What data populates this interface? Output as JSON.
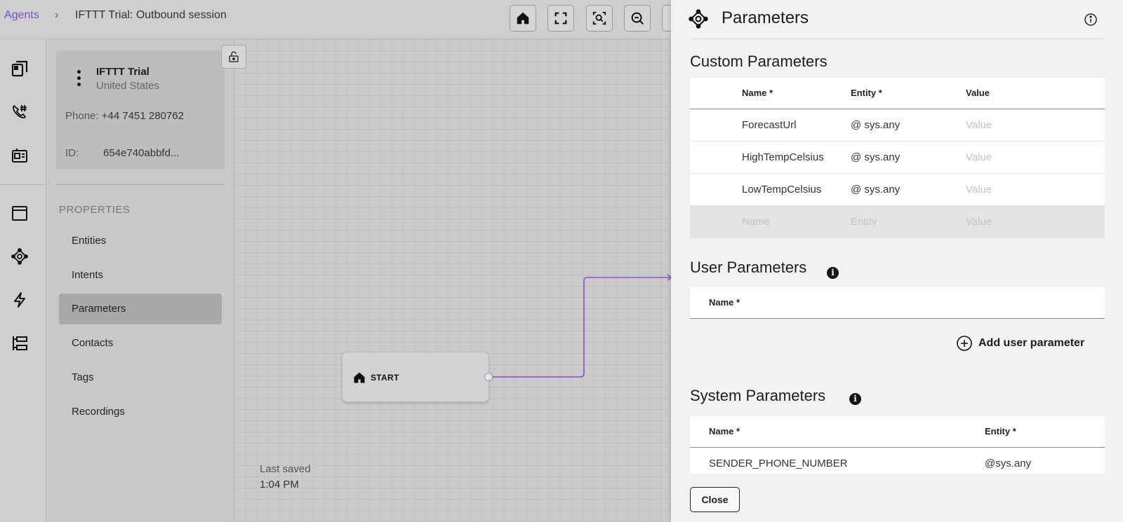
{
  "breadcrumb": {
    "root": "Agents",
    "separator": "›",
    "current": "IFTTT Trial: Outbound session"
  },
  "toolbar": {
    "icons": [
      "home-icon",
      "fullscreen-icon",
      "zoom-fit-icon",
      "zoom-out-icon"
    ]
  },
  "rail": {
    "icons": [
      "flows-icon",
      "phone-hash-icon",
      "id-card-icon",
      "window-icon",
      "parameters-icon",
      "lightning-icon",
      "hierarchy-icon"
    ]
  },
  "agent": {
    "name": "IFTTT Trial",
    "country": "United States",
    "phone_label": "Phone:",
    "phone": "+44 7451 280762",
    "id_label": "ID:",
    "id": "654e740abbfd..."
  },
  "properties": {
    "heading": "PROPERTIES",
    "items": [
      {
        "label": "Entities"
      },
      {
        "label": "Intents"
      },
      {
        "label": "Parameters"
      },
      {
        "label": "Contacts"
      },
      {
        "label": "Tags"
      },
      {
        "label": "Recordings"
      }
    ],
    "active": "Parameters"
  },
  "canvas": {
    "start_node": "START",
    "last_saved_label": "Last saved",
    "last_saved_time": "1:04 PM"
  },
  "parameters_panel": {
    "title": "Parameters",
    "custom": {
      "title": "Custom Parameters",
      "headers": {
        "name": "Name *",
        "entity": "Entity *",
        "value": "Value"
      },
      "rows": [
        {
          "name": "ForecastUrl",
          "entity": "@ sys.any",
          "value_placeholder": "Value"
        },
        {
          "name": "HighTempCelsius",
          "entity": "@ sys.any",
          "value_placeholder": "Value"
        },
        {
          "name": "LowTempCelsius",
          "entity": "@ sys.any",
          "value_placeholder": "Value"
        }
      ],
      "new_row": {
        "name_placeholder": "Name",
        "entity_placeholder": "Entity",
        "value_placeholder": "Value"
      }
    },
    "user": {
      "title": "User Parameters",
      "info": "i",
      "headers": {
        "name": "Name *"
      },
      "add_button": "Add user parameter"
    },
    "system": {
      "title": "System Parameters",
      "info": "i",
      "headers": {
        "name": "Name *",
        "entity": "Entity *"
      },
      "rows": [
        {
          "name": "SENDER_PHONE_NUMBER",
          "entity": "@sys.any"
        }
      ]
    },
    "close_button": "Close"
  },
  "colors": {
    "accent": "#7b4fd9",
    "connector": "#8a4fd6",
    "panel_bg": "#f2f2f3"
  }
}
